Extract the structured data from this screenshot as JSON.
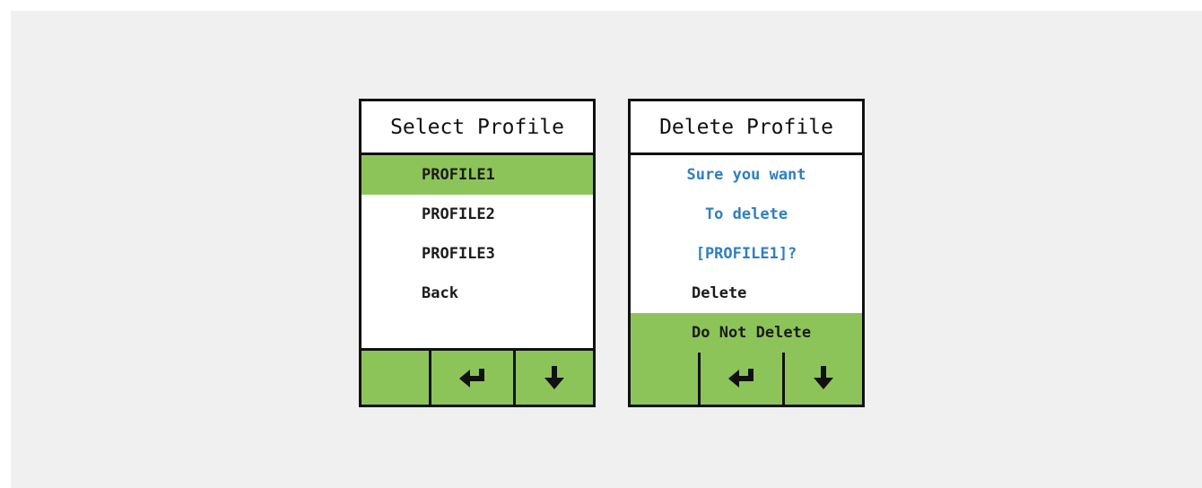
{
  "screens": {
    "select_profile": {
      "title": "Select Profile",
      "items": [
        {
          "label": "PROFILE1",
          "selected": true
        },
        {
          "label": "PROFILE2",
          "selected": false
        },
        {
          "label": "PROFILE3",
          "selected": false
        },
        {
          "label": "Back",
          "selected": false
        }
      ],
      "buttons": [
        "blank",
        "enter-icon",
        "arrow-down-icon"
      ]
    },
    "delete_profile": {
      "title": "Delete Profile",
      "question": [
        "Sure you want",
        "To delete",
        "[PROFILE1]?"
      ],
      "options": [
        {
          "label": "Delete",
          "selected": false
        },
        {
          "label": "Do Not Delete",
          "selected": true
        }
      ],
      "buttons": [
        "blank",
        "enter-icon",
        "arrow-down-icon"
      ]
    }
  },
  "colors": {
    "background": "#f0f0f0",
    "border": "#111111",
    "highlight_green": "#8dc45a",
    "question_blue": "#2f7fc1"
  }
}
